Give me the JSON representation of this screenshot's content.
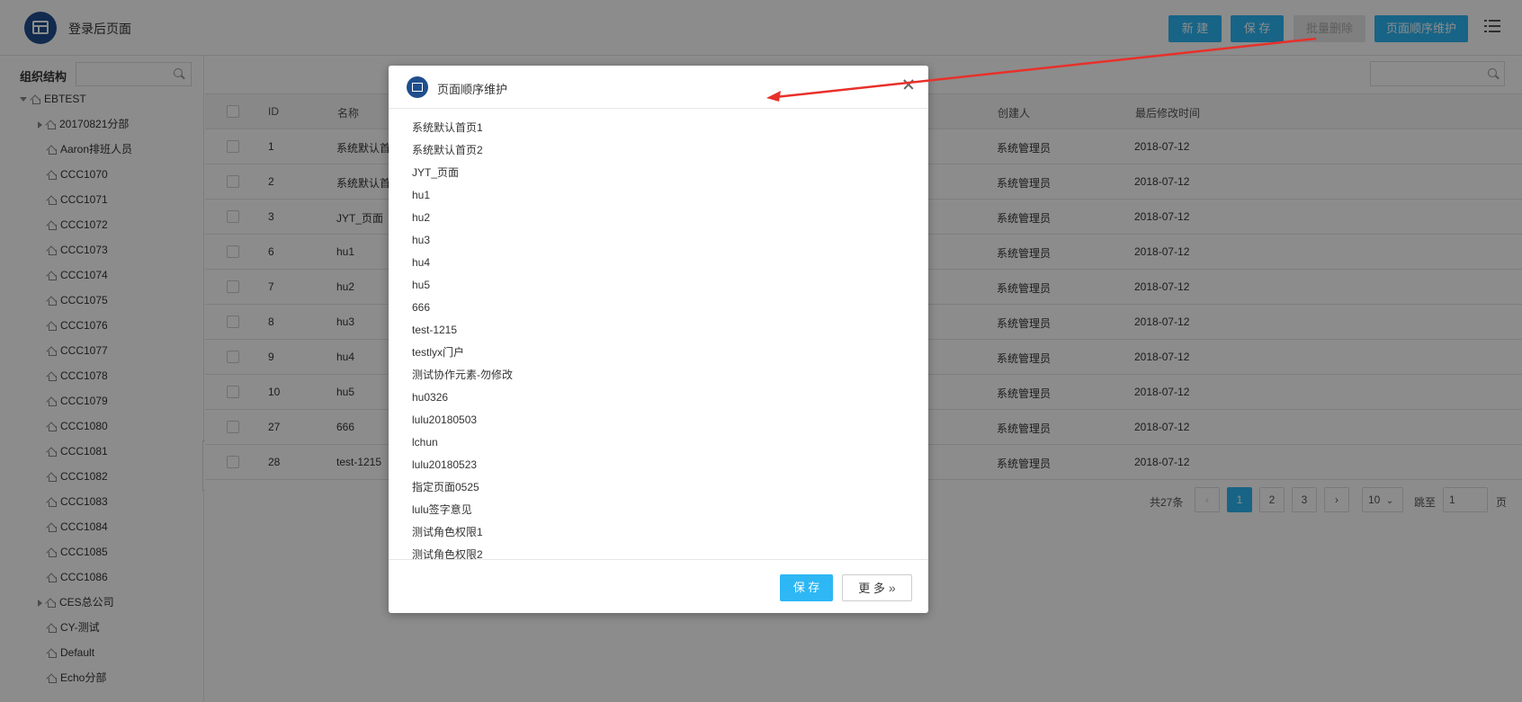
{
  "header": {
    "title": "登录后页面",
    "buttons": {
      "new": "新 建",
      "save": "保 存",
      "batch_delete": "批量删除",
      "page_order": "页面顺序维护"
    }
  },
  "sidebar": {
    "label": "组织结构",
    "search_placeholder": "",
    "tree": [
      {
        "label": "EBTEST",
        "level": 0,
        "caret": "open"
      },
      {
        "label": "20170821分部",
        "level": 1,
        "caret": "closed"
      },
      {
        "label": "Aaron排班人员",
        "level": 1,
        "caret": "none"
      },
      {
        "label": "CCC1070",
        "level": 1,
        "caret": "none"
      },
      {
        "label": "CCC1071",
        "level": 1,
        "caret": "none"
      },
      {
        "label": "CCC1072",
        "level": 1,
        "caret": "none"
      },
      {
        "label": "CCC1073",
        "level": 1,
        "caret": "none"
      },
      {
        "label": "CCC1074",
        "level": 1,
        "caret": "none"
      },
      {
        "label": "CCC1075",
        "level": 1,
        "caret": "none"
      },
      {
        "label": "CCC1076",
        "level": 1,
        "caret": "none"
      },
      {
        "label": "CCC1077",
        "level": 1,
        "caret": "none"
      },
      {
        "label": "CCC1078",
        "level": 1,
        "caret": "none"
      },
      {
        "label": "CCC1079",
        "level": 1,
        "caret": "none"
      },
      {
        "label": "CCC1080",
        "level": 1,
        "caret": "none"
      },
      {
        "label": "CCC1081",
        "level": 1,
        "caret": "none"
      },
      {
        "label": "CCC1082",
        "level": 1,
        "caret": "none"
      },
      {
        "label": "CCC1083",
        "level": 1,
        "caret": "none"
      },
      {
        "label": "CCC1084",
        "level": 1,
        "caret": "none"
      },
      {
        "label": "CCC1085",
        "level": 1,
        "caret": "none"
      },
      {
        "label": "CCC1086",
        "level": 1,
        "caret": "none"
      },
      {
        "label": "CES总公司",
        "level": 1,
        "caret": "closed"
      },
      {
        "label": "CY-测试",
        "level": 1,
        "caret": "none"
      },
      {
        "label": "Default",
        "level": 1,
        "caret": "none"
      },
      {
        "label": "Echo分部",
        "level": 1,
        "caret": "none"
      }
    ]
  },
  "table": {
    "search_placeholder": "",
    "columns": {
      "id": "ID",
      "name": "名称",
      "creator": "创建人",
      "modified": "最后修改时间"
    },
    "rows": [
      {
        "id": "1",
        "name": "系统默认首",
        "creator": "系统管理员",
        "modified": "2018-07-12"
      },
      {
        "id": "2",
        "name": "系统默认首",
        "creator": "系统管理员",
        "modified": "2018-07-12"
      },
      {
        "id": "3",
        "name": "JYT_页面",
        "creator": "系统管理员",
        "modified": "2018-07-12"
      },
      {
        "id": "6",
        "name": "hu1",
        "creator": "系统管理员",
        "modified": "2018-07-12"
      },
      {
        "id": "7",
        "name": "hu2",
        "creator": "系统管理员",
        "modified": "2018-07-12"
      },
      {
        "id": "8",
        "name": "hu3",
        "creator": "系统管理员",
        "modified": "2018-07-12"
      },
      {
        "id": "9",
        "name": "hu4",
        "creator": "系统管理员",
        "modified": "2018-07-12"
      },
      {
        "id": "10",
        "name": "hu5",
        "creator": "系统管理员",
        "modified": "2018-07-12"
      },
      {
        "id": "27",
        "name": "666",
        "creator": "系统管理员",
        "modified": "2018-07-12"
      },
      {
        "id": "28",
        "name": "test-1215",
        "creator": "系统管理员",
        "modified": "2018-07-12"
      }
    ]
  },
  "pagination": {
    "total": "共27条",
    "prev": "‹",
    "pages": [
      "1",
      "2",
      "3"
    ],
    "current": "1",
    "next": "›",
    "page_size": "10",
    "jump_label": "跳至",
    "jump_value": "1",
    "page_suffix": "页"
  },
  "modal": {
    "title": "页面顺序维护",
    "items": [
      "系统默认首页1",
      "系统默认首页2",
      "JYT_页面",
      "hu1",
      "hu2",
      "hu3",
      "hu4",
      "hu5",
      "666",
      "test-1215",
      "testlyx门户",
      "测试协作元素-勿修改",
      "hu0326",
      "lulu20180503",
      "lchun",
      "lulu20180523",
      "指定页面0525",
      "lulu签字意见",
      "测试角色权限1",
      "测试角色权限2"
    ],
    "save_label": "保 存",
    "more_label": "更 多"
  },
  "colors": {
    "accent": "#2db7f5",
    "brand": "#1f4e8c",
    "annotation_arrow": "#e8302a"
  }
}
